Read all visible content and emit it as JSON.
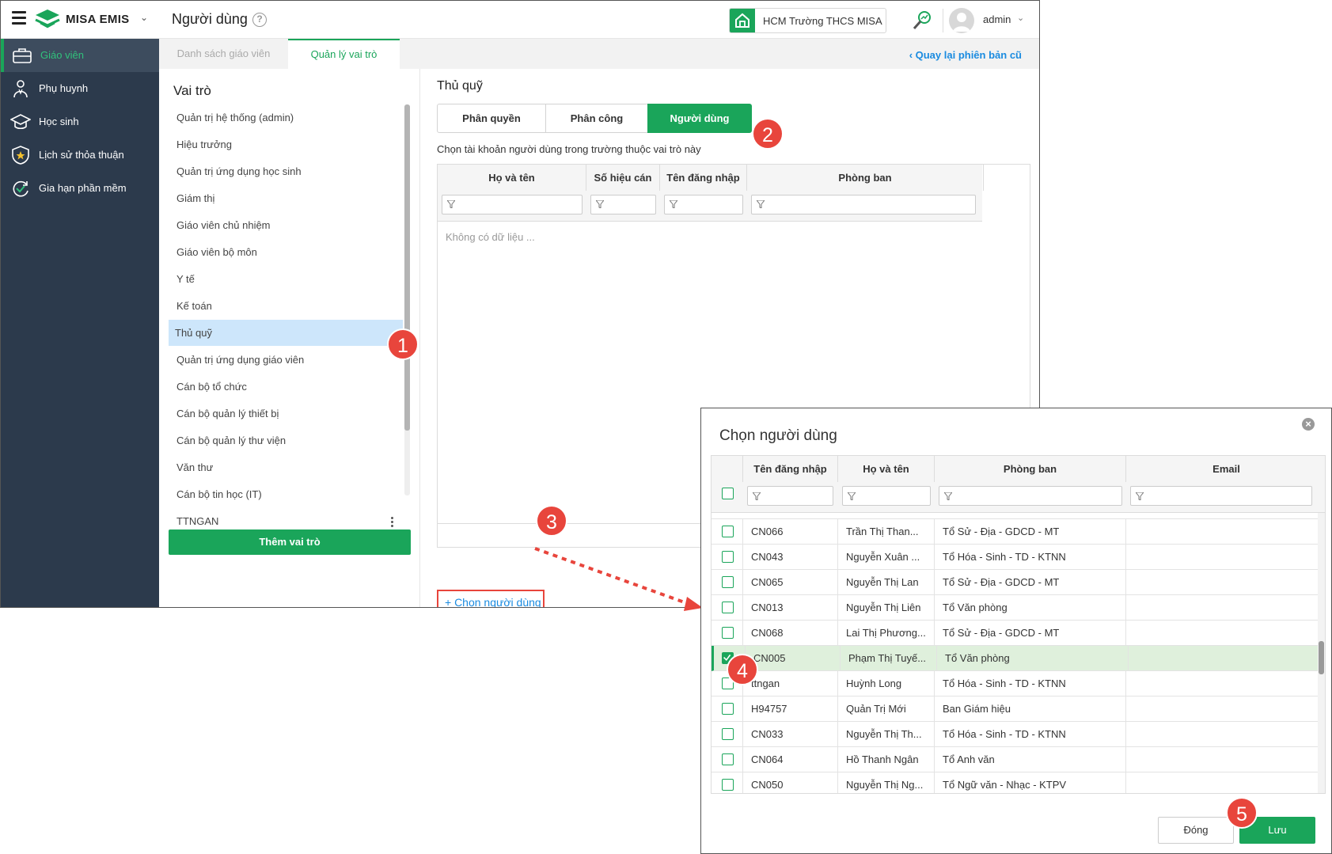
{
  "app": {
    "brand": "MISA EMIS",
    "page_title": "Người dùng",
    "school": "HCM Trường THCS MISA",
    "user": "admin"
  },
  "sidebar": {
    "items": [
      {
        "label": "Giáo viên",
        "icon": "teacher-briefcase-icon",
        "active": true
      },
      {
        "label": "Phụ huynh",
        "icon": "parent-person-icon"
      },
      {
        "label": "Học sinh",
        "icon": "graduation-cap-icon"
      },
      {
        "label": "Lịch sử thỏa thuận",
        "icon": "shield-star-icon"
      },
      {
        "label": "Gia hạn phần mềm",
        "icon": "refresh-check-icon"
      }
    ]
  },
  "tabs": {
    "teacher_list": "Danh sách giáo viên",
    "role_manage": "Quản lý vai trò",
    "back_link": "‹ Quay lại phiên bản cũ"
  },
  "roles": {
    "title": "Vai trò",
    "items": [
      "Quản trị hệ thống (admin)",
      "Hiệu trưởng",
      "Quản trị ứng dụng học sinh",
      "Giám thị",
      "Giáo viên chủ nhiệm",
      "Giáo viên bộ môn",
      "Y tế",
      "Kế toán",
      "Thủ quỹ",
      "Quản trị ứng dụng giáo viên",
      "Cán bộ tổ chức",
      "Cán bộ quản lý thiết bị",
      "Cán bộ quản lý thư viện",
      "Văn thư",
      "Cán bộ tin học (IT)",
      "TTNGAN"
    ],
    "selected_index": 8,
    "add_button": "Thêm vai trò"
  },
  "detail": {
    "title": "Thủ quỹ",
    "segments": [
      "Phân quyền",
      "Phân công",
      "Người dùng"
    ],
    "active_segment": 2,
    "hint": "Chọn tài khoản người dùng trong trường thuộc vai trò này",
    "columns": [
      "Họ và tên",
      "Số hiệu cán",
      "Tên đăng nhập",
      "Phòng ban"
    ],
    "empty_text": "Không có dữ liệu ...",
    "choose_link": "+ Chọn người dùng"
  },
  "dialog": {
    "title": "Chọn người dùng",
    "columns": [
      "Tên đăng nhập",
      "Họ và tên",
      "Phòng ban",
      "Email"
    ],
    "rows": [
      {
        "login": "CN066",
        "name": "Trần Thị Than...",
        "dept": "Tổ Sử - Địa - GDCD - MT",
        "email": "",
        "checked": false
      },
      {
        "login": "CN043",
        "name": "Nguyễn Xuân ...",
        "dept": "Tổ Hóa - Sinh - TD - KTNN",
        "email": "",
        "checked": false
      },
      {
        "login": "CN065",
        "name": "Nguyễn Thị Lan",
        "dept": "Tổ Sử - Địa - GDCD - MT",
        "email": "",
        "checked": false
      },
      {
        "login": "CN013",
        "name": "Nguyễn Thị Liên",
        "dept": "Tổ Văn phòng",
        "email": "",
        "checked": false
      },
      {
        "login": "CN068",
        "name": "Lai Thị Phương...",
        "dept": "Tổ Sử - Địa - GDCD - MT",
        "email": "",
        "checked": false
      },
      {
        "login": "CN005",
        "name": "Phạm Thị Tuyế...",
        "dept": "Tổ Văn phòng",
        "email": "",
        "checked": true
      },
      {
        "login": "ttngan",
        "name": "Huỳnh Long",
        "dept": "Tổ Hóa - Sinh - TD - KTNN",
        "email": "",
        "checked": false
      },
      {
        "login": "H94757",
        "name": "Quản Trị Mới",
        "dept": "Ban Giám hiệu",
        "email": "",
        "checked": false
      },
      {
        "login": "CN033",
        "name": "Nguyễn Thị Th...",
        "dept": "Tổ Hóa - Sinh - TD - KTNN",
        "email": "",
        "checked": false
      },
      {
        "login": "CN064",
        "name": "Hồ Thanh Ngân",
        "dept": "Tổ Anh văn",
        "email": "",
        "checked": false
      },
      {
        "login": "CN050",
        "name": "Nguyễn Thị Ng...",
        "dept": "Tổ Ngữ văn - Nhạc - KTPV",
        "email": "",
        "checked": false
      }
    ],
    "close_button": "Đóng",
    "save_button": "Lưu"
  },
  "badges": [
    "1",
    "2",
    "3",
    "4",
    "5"
  ],
  "colors": {
    "brand_green": "#1aa55a",
    "sidebar_bg": "#2c3a4c",
    "link_blue": "#1a8be0",
    "badge_red": "#e8453c",
    "selected_role": "#cde6fb"
  }
}
